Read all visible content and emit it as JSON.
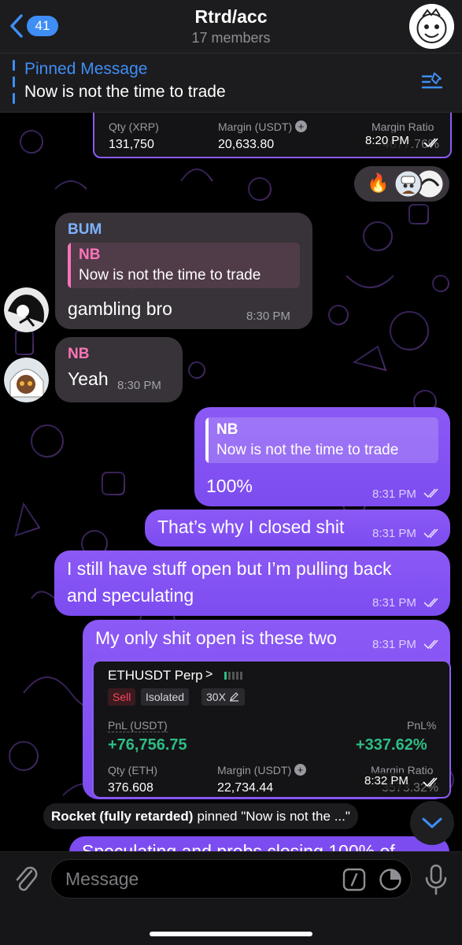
{
  "header": {
    "back_badge": "41",
    "title": "Rtrd/acc",
    "subtitle": "17 members"
  },
  "pinned": {
    "label": "Pinned Message",
    "text": "Now is not the time to trade"
  },
  "card_top": {
    "qty_label": "Qty (XRP)",
    "qty_value": "131,750",
    "margin_label": "Margin (USDT)",
    "margin_value": "20,633.80",
    "ratio_label": "Margin Ratio",
    "ratio_value": "4677.76%",
    "time": "8:20 PM"
  },
  "reaction": {
    "emoji": "🔥"
  },
  "messages": [
    {
      "sender": "BUM",
      "reply_name": "NB",
      "reply_text": "Now is not the time to trade",
      "text": "gambling bro",
      "time": "8:30 PM"
    },
    {
      "sender": "NB",
      "text": "Yeah",
      "time": "8:30 PM"
    },
    {
      "reply_name": "NB",
      "reply_text": "Now is not the time to trade",
      "text": "100%",
      "time": "8:31 PM"
    },
    {
      "text": "That’s why I closed shit",
      "time": "8:31 PM"
    },
    {
      "text_line1": "I still have stuff open but I’m pulling back",
      "text_line2": "and speculating",
      "time": "8:31 PM"
    },
    {
      "text": "My only shit open is these two",
      "time": "8:31 PM"
    }
  ],
  "card_eth": {
    "pair": "ETHUSDT Perp",
    "chevron": ">",
    "tags": [
      "Sell",
      "Isolated",
      "30X"
    ],
    "pnl_label": "PnL (USDT)",
    "pnl_value": "+76,756.75",
    "pnlpct_label": "PnL%",
    "pnlpct_value": "+337.62%",
    "qty_label": "Qty (ETH)",
    "qty_value": "376.608",
    "margin_label": "Margin (USDT)",
    "margin_value": "22,734.44",
    "ratio_label": "Margin Ratio",
    "ratio_value": "3573.32%",
    "time": "8:32 PM"
  },
  "system": {
    "actor": "Rocket (fully retarded)",
    "text": "pinned \"Now is not the ...\""
  },
  "peek_text": "Speculating and probs closing 100% of",
  "input": {
    "placeholder": "Message"
  },
  "colors": {
    "accent": "#3f8ef5",
    "outgoing": "#8b59f5",
    "incoming": "#3a363c",
    "bum_name": "#7fb2ff",
    "nb_name": "#ff74b8",
    "pnl_green": "#2ebd85",
    "sell_red": "#f6465d"
  }
}
